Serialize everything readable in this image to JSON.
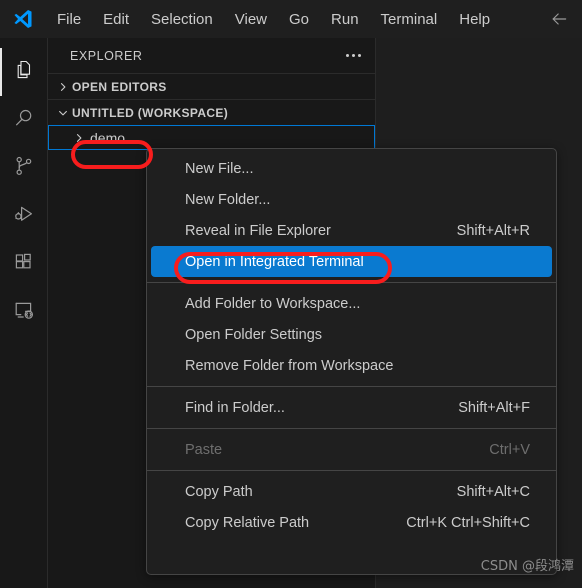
{
  "titlebar": {
    "logo_icon": "vscode-logo-icon",
    "back_icon": "back-arrow-icon",
    "menus": [
      {
        "label": "File"
      },
      {
        "label": "Edit"
      },
      {
        "label": "Selection"
      },
      {
        "label": "View"
      },
      {
        "label": "Go"
      },
      {
        "label": "Run"
      },
      {
        "label": "Terminal"
      },
      {
        "label": "Help"
      }
    ]
  },
  "activitybar": {
    "items": [
      {
        "name": "explorer",
        "icon": "files-icon",
        "active": true
      },
      {
        "name": "search",
        "icon": "search-icon",
        "active": false
      },
      {
        "name": "source-control",
        "icon": "source-control-icon",
        "active": false
      },
      {
        "name": "run-and-debug",
        "icon": "run-debug-icon",
        "active": false
      },
      {
        "name": "extensions",
        "icon": "extensions-icon",
        "active": false
      },
      {
        "name": "remote-explorer",
        "icon": "remote-explorer-icon",
        "active": false
      }
    ]
  },
  "sidebar": {
    "title": "EXPLORER",
    "more_actions_icon": "ellipsis-icon",
    "sections": [
      {
        "label": "OPEN EDITORS",
        "expanded": false,
        "chevron_icon": "chevron-right-icon"
      },
      {
        "label": "UNTITLED (WORKSPACE)",
        "expanded": true,
        "chevron_icon": "chevron-down-icon"
      }
    ],
    "tree": [
      {
        "label": "demo",
        "expanded": false,
        "focused": true,
        "chevron_icon": "chevron-right-icon"
      }
    ]
  },
  "context_menu": {
    "items": [
      {
        "label": "New File...",
        "key": "",
        "state": "normal"
      },
      {
        "label": "New Folder...",
        "key": "",
        "state": "normal"
      },
      {
        "label": "Reveal in File Explorer",
        "key": "Shift+Alt+R",
        "state": "normal"
      },
      {
        "label": "Open in Integrated Terminal",
        "key": "",
        "state": "selected"
      },
      {
        "type": "separator"
      },
      {
        "label": "Add Folder to Workspace...",
        "key": "",
        "state": "normal"
      },
      {
        "label": "Open Folder Settings",
        "key": "",
        "state": "normal"
      },
      {
        "label": "Remove Folder from Workspace",
        "key": "",
        "state": "normal"
      },
      {
        "type": "separator"
      },
      {
        "label": "Find in Folder...",
        "key": "Shift+Alt+F",
        "state": "normal"
      },
      {
        "type": "separator"
      },
      {
        "label": "Paste",
        "key": "Ctrl+V",
        "state": "disabled"
      },
      {
        "type": "separator"
      },
      {
        "label": "Copy Path",
        "key": "Shift+Alt+C",
        "state": "normal"
      },
      {
        "label": "Copy Relative Path",
        "key": "Ctrl+K Ctrl+Shift+C",
        "state": "normal"
      }
    ]
  },
  "annotations": [
    {
      "name": "demo-highlight",
      "target": "demo"
    },
    {
      "name": "open-in-integrated-terminal-highlight",
      "target": "Open in Integrated Terminal"
    }
  ],
  "watermark": {
    "text": "CSDN @段鸿潭"
  },
  "colors": {
    "accent_blue": "#0a7ad0",
    "annotation_red": "#f81d1d",
    "sidebar_bg": "#181818",
    "editor_bg": "#1e1e1e",
    "menu_bg": "#1f1f1f",
    "text": "#cccccc"
  }
}
